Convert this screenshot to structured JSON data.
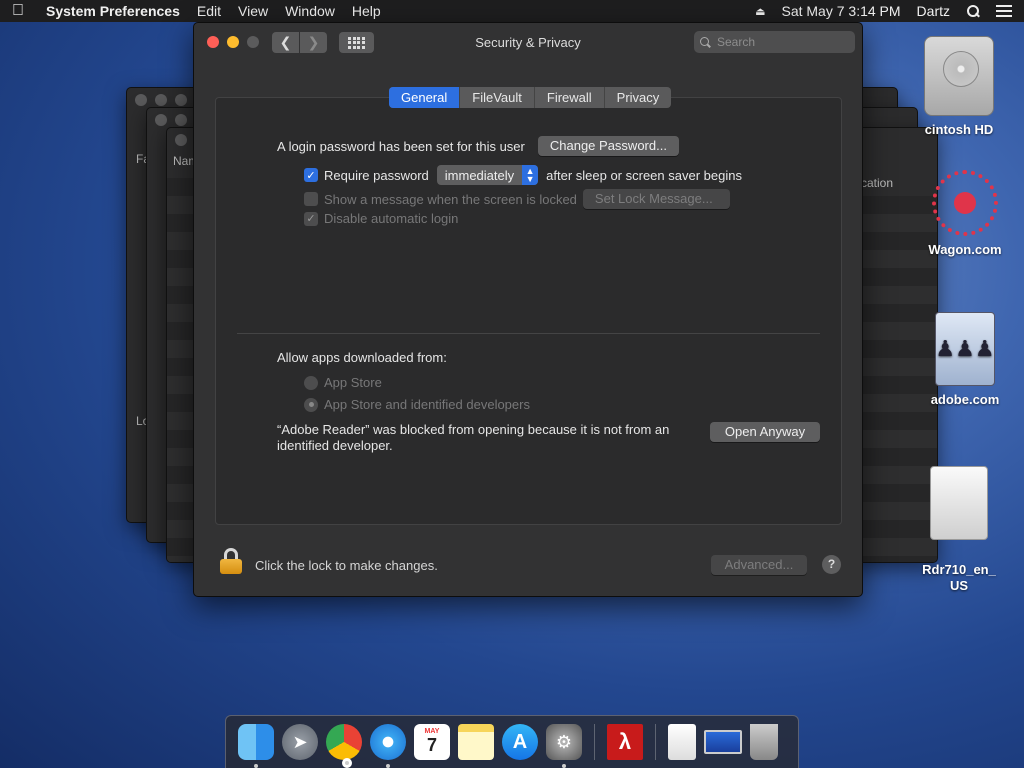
{
  "menubar": {
    "app_name": "System Preferences",
    "menus": [
      "Edit",
      "View",
      "Window",
      "Help"
    ],
    "datetime": "Sat May 7  3:14 PM",
    "user": "Dartz"
  },
  "window": {
    "title": "Security & Privacy",
    "search_placeholder": "Search",
    "tabs": [
      "General",
      "FileVault",
      "Firewall",
      "Privacy"
    ],
    "active_tab": "General"
  },
  "general": {
    "login_password_text": "A login password has been set for this user",
    "change_password_button": "Change Password...",
    "require_password_label": "Require password",
    "require_password_checked": true,
    "require_password_delay": "immediately",
    "after_sleep_text": "after sleep or screen saver begins",
    "show_message_label": "Show a message when the screen is locked",
    "set_lock_message_button": "Set Lock Message...",
    "disable_auto_login_label": "Disable automatic login",
    "allow_apps_label": "Allow apps downloaded from:",
    "radio_app_store": "App Store",
    "radio_identified": "App Store and identified developers",
    "blocked_message_line1": "“Adobe Reader” was blocked from opening because it is not from an",
    "blocked_message_line2": "identified developer.",
    "open_anyway_button": "Open Anyway"
  },
  "footer": {
    "lock_text": "Click the lock to make changes.",
    "advanced_button": "Advanced...",
    "help_button": "?"
  },
  "background_windows": {
    "label_fa": "Fa",
    "label_nam": "Nam",
    "label_lo": "Lo",
    "label_cation": "cation"
  },
  "desktop_icons": [
    {
      "label": "cintosh HD"
    },
    {
      "label": "Wagon.com"
    },
    {
      "label": "adobe.com"
    },
    {
      "label": "Rdr710_en_\nUS"
    }
  ],
  "dock": {
    "calendar_month": "MAY",
    "calendar_day": "7"
  },
  "colors": {
    "accent": "#2d6fe0",
    "window_bg": "#323233",
    "close": "#fe5f57",
    "minimize": "#febc2e"
  }
}
